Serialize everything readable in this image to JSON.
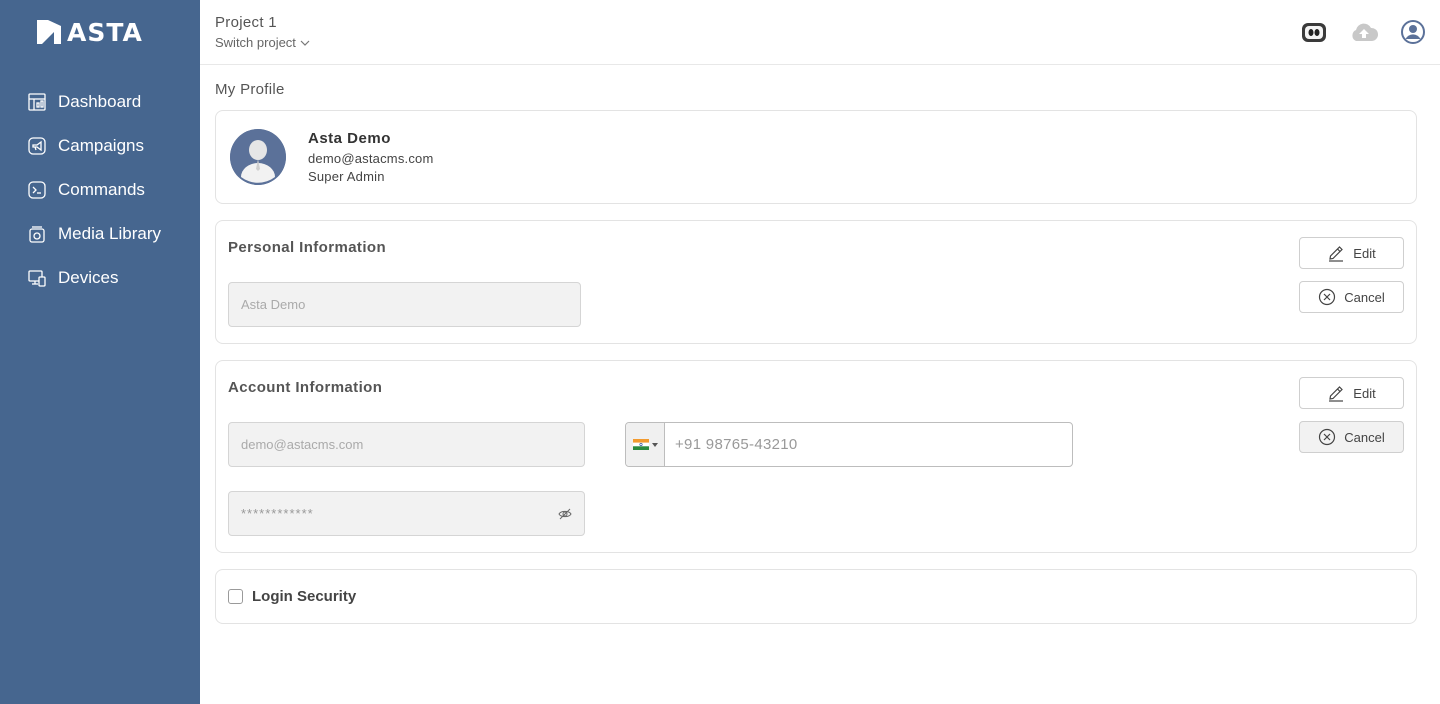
{
  "brand": {
    "name": "ASTA",
    "color": "#46668f"
  },
  "sidebar": {
    "items": [
      {
        "label": "Dashboard",
        "icon": "dashboard-icon"
      },
      {
        "label": "Campaigns",
        "icon": "megaphone-icon"
      },
      {
        "label": "Commands",
        "icon": "terminal-icon"
      },
      {
        "label": "Media Library",
        "icon": "media-icon"
      },
      {
        "label": "Devices",
        "icon": "devices-icon"
      }
    ]
  },
  "header": {
    "project": "Project 1",
    "switch_label": "Switch project",
    "icons": [
      "robot-icon",
      "cloud-upload-icon",
      "user-icon"
    ]
  },
  "page": {
    "title": "My Profile"
  },
  "profile": {
    "name": "Asta Demo",
    "email": "demo@astacms.com",
    "role": "Super Admin"
  },
  "personal": {
    "title": "Personal Information",
    "edit_label": "Edit",
    "cancel_label": "Cancel",
    "name_placeholder": "Asta Demo"
  },
  "account": {
    "title": "Account Information",
    "edit_label": "Edit",
    "cancel_label": "Cancel",
    "email_placeholder": "demo@astacms.com",
    "phone": "+91 98765-43210",
    "password_mask": "************"
  },
  "security": {
    "label": "Login Security",
    "checked": false
  }
}
